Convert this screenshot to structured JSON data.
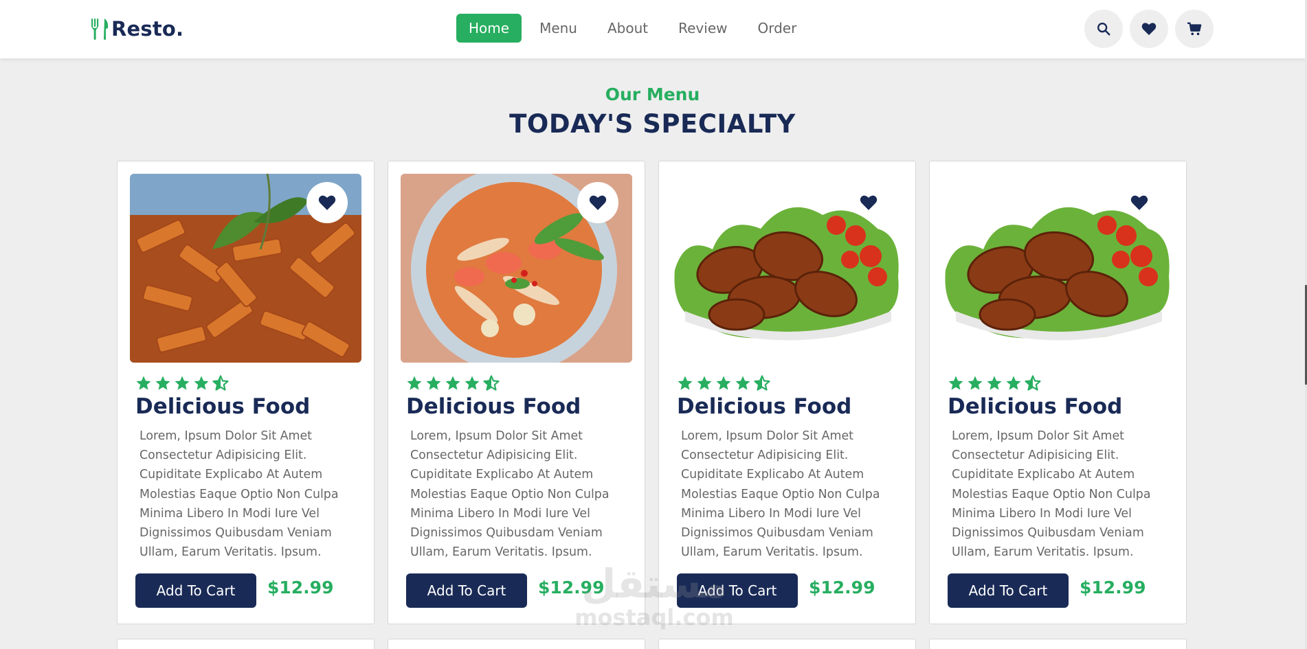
{
  "brand": {
    "name": "Resto.",
    "logo_icon": "utensils-icon",
    "color": "#27ae60"
  },
  "nav": {
    "items": [
      {
        "label": "Home",
        "active": true
      },
      {
        "label": "Menu",
        "active": false
      },
      {
        "label": "About",
        "active": false
      },
      {
        "label": "Review",
        "active": false
      },
      {
        "label": "Order",
        "active": false
      }
    ]
  },
  "header_icons": [
    "search-icon",
    "heart-icon",
    "cart-icon"
  ],
  "section": {
    "sub_heading": "Our Menu",
    "heading": "TODAY'S SPECIALTY"
  },
  "cards": [
    {
      "image": "pasta-photo",
      "rating": 4.5,
      "title": "Delicious Food",
      "description": "Lorem, Ipsum Dolor Sit Amet Consectetur Adipisicing Elit. Cupiditate Explicabo At Autem Molestias Eaque Optio Non Culpa Minima Libero In Modi Iure Vel Dignissimos Quibusdam Veniam Ullam, Earum Veritatis. Ipsum.",
      "button": "Add To Cart",
      "price": "$12.99"
    },
    {
      "image": "noodle-soup-photo",
      "rating": 4.5,
      "title": "Delicious Food",
      "description": "Lorem, Ipsum Dolor Sit Amet Consectetur Adipisicing Elit. Cupiditate Explicabo At Autem Molestias Eaque Optio Non Culpa Minima Libero In Modi Iure Vel Dignissimos Quibusdam Veniam Ullam, Earum Veritatis. Ipsum.",
      "button": "Add To Cart",
      "price": "$12.99"
    },
    {
      "image": "chicken-wings-photo",
      "rating": 4.5,
      "title": "Delicious Food",
      "description": "Lorem, Ipsum Dolor Sit Amet Consectetur Adipisicing Elit. Cupiditate Explicabo At Autem Molestias Eaque Optio Non Culpa Minima Libero In Modi Iure Vel Dignissimos Quibusdam Veniam Ullam, Earum Veritatis. Ipsum.",
      "button": "Add To Cart",
      "price": "$12.99"
    },
    {
      "image": "chicken-wings-photo",
      "rating": 4.5,
      "title": "Delicious Food",
      "description": "Lorem, Ipsum Dolor Sit Amet Consectetur Adipisicing Elit. Cupiditate Explicabo At Autem Molestias Eaque Optio Non Culpa Minima Libero In Modi Iure Vel Dignissimos Quibusdam Veniam Ullam, Earum Veritatis. Ipsum.",
      "button": "Add To Cart",
      "price": "$12.99"
    }
  ],
  "watermark": {
    "arabic": "مستقل",
    "latin": "mostaql.com"
  },
  "colors": {
    "primary": "#27ae60",
    "dark": "#192a56",
    "text": "#666666",
    "background": "#eeeeee"
  }
}
